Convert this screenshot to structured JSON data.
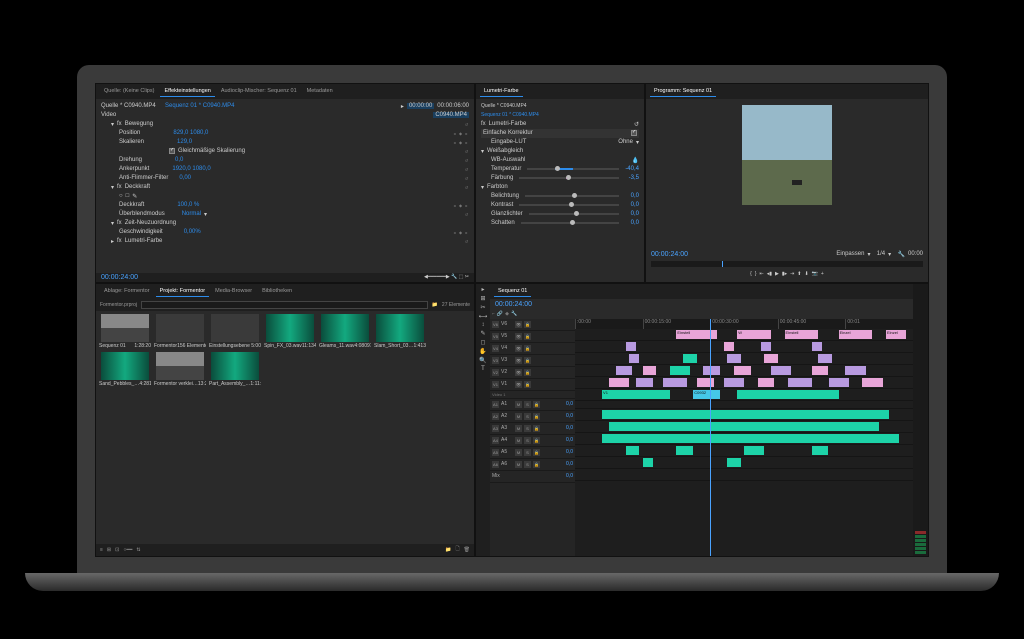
{
  "effects": {
    "tabs": [
      "Quelle: (Keine Clips)",
      "Effekteinstellungen",
      "Audioclip-Mischer: Sequenz 01",
      "Metadaten"
    ],
    "activeTab": 1,
    "source": "Quelle * C0940.MP4",
    "sequence": "Sequenz 01 * C0940.MP4",
    "tc1": "00:00:00",
    "tc2": "00:00:06:00",
    "clipName": "C0940.MP4",
    "sections": {
      "video": "Video",
      "motion": "Bewegung",
      "position": "Position",
      "posVal": "829,0   1080,0",
      "scale": "Skalieren",
      "scaleVal": "129,0",
      "uniform": "Gleichmäßige Skalierung",
      "rotation": "Drehung",
      "rotVal": "0,0",
      "anchor": "Ankerpunkt",
      "anchorVal": "1920,0   1080,0",
      "flicker": "Anti-Flimmer-Filter",
      "flickerVal": "0,00",
      "opacity": "Deckkraft",
      "opacityVal": "100,0 %",
      "blend": "Überblendmodus",
      "blendVal": "Normal",
      "timeRemap": "Zeit-Neuzuordnung",
      "speed": "Geschwindigkeit",
      "speedVal": "0,00%",
      "lumetri": "Lumetri-Farbe"
    }
  },
  "lumetri": {
    "title": "Lumetri-Farbe",
    "source": "Quelle * C0940.MP4",
    "sequence": "Sequenz 01 * C0940.MP4",
    "master": "Lumetri-Farbe",
    "section": "Einfache Korrektur",
    "lut": "Eingabe-LUT",
    "lutVal": "Ohne",
    "wb": "Weißabgleich",
    "wbsel": "WB-Auswahl",
    "temp": "Temperatur",
    "tempVal": "-40,4",
    "tint": "Färbung",
    "tintVal": "-3,5",
    "tone": "Farbton",
    "exposure": "Belichtung",
    "exposureVal": "0,0",
    "contrast": "Kontrast",
    "contrastVal": "0,0",
    "highlights": "Glanzlichter",
    "highlightsVal": "0,0",
    "shadows": "Schatten",
    "shadowsVal": "0,0"
  },
  "program": {
    "title": "Programm: Sequenz 01",
    "tc": "00:00:24:00",
    "fit": "Einpassen",
    "zoom": "1/4",
    "duration": "00:00"
  },
  "project": {
    "tabs": [
      "Ablage: Formentor",
      "Projekt: Formentor",
      "Media-Browser",
      "Bibliotheken"
    ],
    "activeTab": 1,
    "file": "Formentor.prproj",
    "count": "27 Elemente",
    "bins": [
      {
        "name": "Sequenz 01",
        "dur": "1:28:20",
        "type": "seq"
      },
      {
        "name": "Formentor",
        "dur": "156 Elemente",
        "type": "folder"
      },
      {
        "name": "Einstellungsebene",
        "dur": "5:00",
        "type": "adj"
      },
      {
        "name": "Spin_FX_03.wav",
        "dur": "11:13489",
        "type": "wave"
      },
      {
        "name": "Gleams_11.wav",
        "dur": "4:08097",
        "type": "wave"
      },
      {
        "name": "Slam_Short_03…",
        "dur": "1:41358",
        "type": "wave"
      },
      {
        "name": "Sand_Pebbles_…",
        "dur": "4:28188",
        "type": "wave"
      },
      {
        "name": "Formentor verklei…",
        "dur": "13:22",
        "type": "seq"
      },
      {
        "name": "Part_Assembly_…",
        "dur": "1:11:18",
        "type": "wave"
      }
    ]
  },
  "timeline": {
    "title": "Sequenz 01",
    "tc": "00:00:24:00",
    "ruler": [
      ":00:00",
      "00:00:15:00",
      "00:00:30:00",
      "00:00:45:00",
      "00:01"
    ],
    "videoTracks": [
      "V6",
      "V5",
      "V4",
      "V3",
      "V2",
      "V1"
    ],
    "v1label": "Video 1",
    "audioTracks": [
      "A1",
      "A2",
      "A3",
      "A4",
      "A5",
      "A6"
    ],
    "mixLabel": "Mix",
    "clipLabels": {
      "einstell": "Einstell",
      "w": "W",
      "einzel": "Einzel",
      "c0932": "C0932"
    }
  },
  "tools": [
    "▸",
    "⊞",
    "✂",
    "⟷",
    "↕",
    "✎",
    "◻",
    "✋",
    "🔍",
    "T"
  ]
}
